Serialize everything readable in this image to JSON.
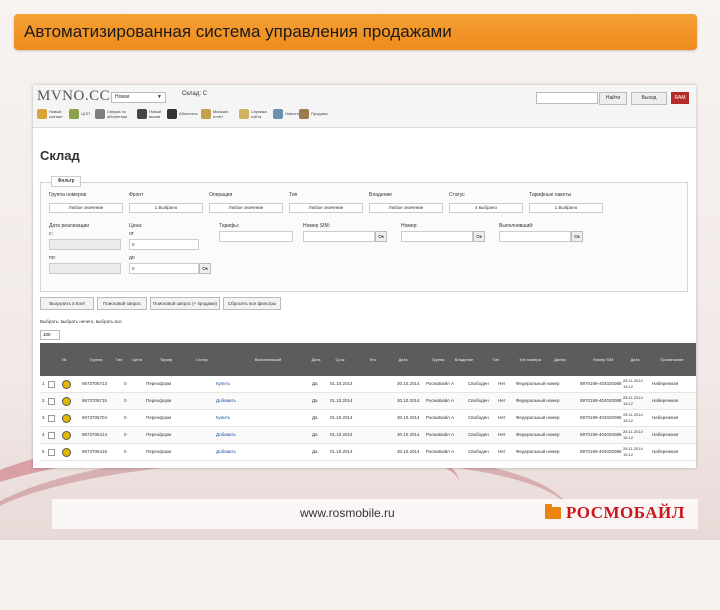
{
  "slide": {
    "title": "Автоматизированная система управления продажами",
    "footer_url": "www.rosmobile.ru",
    "brand": "РОСМОБАЙЛ",
    "colors": {
      "title_bar": "#ee8a1c",
      "brand_red": "#c9171b",
      "header_gray": "#5c5c5c"
    }
  },
  "app": {
    "logo": "MVNO.CC",
    "top_select": "Новая",
    "store_label": "Склад: С",
    "search_button": "Найти",
    "logout_button": "Выход",
    "red_button": "RAM",
    "nav": [
      "Новый контакт",
      "ЦОП",
      "Сверка по абонентам",
      "Новый вызов",
      "Абоненты",
      "Магазин отчёт",
      "Справка счёта",
      "Новости",
      "Продажи"
    ],
    "page_title": "Склад",
    "filter_tab": "Фильтр",
    "filters": {
      "labels": [
        "Группа номеров",
        "Фронт",
        "Операция",
        "Тип",
        "Владение",
        "Статус",
        "Тарифные пакеты"
      ],
      "values": [
        "Любое значение",
        "1 Выбрано",
        "Любое значение",
        "Любое значение",
        "Любое значение",
        "4 выбрано",
        "1 Выбрано"
      ],
      "date_label": "Дата реализации",
      "from_label": "с:",
      "to_label": "по:",
      "price_label": "Цена:",
      "price_from": "от",
      "price_to": "до",
      "price_from_val": "0",
      "price_to_val": "0",
      "tariff_label": "Тарифы:",
      "sim_label": "Номер SIM:",
      "number_label": "Номер:",
      "owner_label": "Выполнивший:",
      "ok": "Ок"
    },
    "actions": [
      "Выгрузить в Exel",
      "Поисковой запрос",
      "Поисковой запрос (+ продажи)",
      "Сбросить все фильтры"
    ],
    "selection_text": "Выбрать: выбрать ничего, выбрать все",
    "page_size": "100",
    "columns": [
      "№",
      "Группа",
      "Тип",
      "Цена",
      "Тариф",
      "Статус",
      "Выполнивший",
      "Дата",
      "Срок",
      "Кто",
      "Дата",
      "Группа",
      "Владение",
      "Тип",
      "Тип номера",
      "Дилер",
      "Номер SIM",
      "Дата",
      "Примечание"
    ],
    "rows": [
      {
        "n": "1",
        "num": "9673705713",
        "v": "0",
        "tariff": "Переоформ",
        "status": "Купить",
        "flag": "Да",
        "date1": "01.10.2014",
        "date2": "30.10.2014",
        "owner": "РосмоБайл А",
        "state": "Свободен",
        "yn": "Нет",
        "type": "Федеральный номер",
        "sim": "8970199-404020088",
        "date3": "28.11.2014 15:12",
        "note": "Набережная"
      },
      {
        "n": "2",
        "num": "9673705715",
        "v": "0",
        "tariff": "Переоформ",
        "status": "Добавить",
        "flag": "Да",
        "date1": "01.10.2014",
        "date2": "30.10.2014",
        "owner": "РосмоБайл А",
        "state": "Свободен",
        "yn": "Нет",
        "type": "Федеральный номер",
        "sim": "8970199-404020088",
        "date3": "28.11.2014 15:12",
        "note": "Набережная"
      },
      {
        "n": "3",
        "num": "9673705704",
        "v": "0",
        "tariff": "Переоформ",
        "status": "Купить",
        "flag": "Да",
        "date1": "01.10.2014",
        "date2": "30.10.2014",
        "owner": "РосмоБайл А",
        "state": "Свободен",
        "yn": "Нет",
        "type": "Федеральный номер",
        "sim": "8970199-404020086",
        "date3": "28.11.2014 15:12",
        "note": "Набережная"
      },
      {
        "n": "4",
        "num": "9673705414",
        "v": "0",
        "tariff": "Переоформ",
        "status": "Добавить",
        "flag": "Да",
        "date1": "01.10.2014",
        "date2": "30.10.2014",
        "owner": "РосмоБайл А",
        "state": "Свободен",
        "yn": "Нет",
        "type": "Федеральный номер",
        "sim": "8970199-404020086",
        "date3": "28.11.2014 15:12",
        "note": "Набережная"
      },
      {
        "n": "5",
        "num": "9673705416",
        "v": "0",
        "tariff": "Переоформ",
        "status": "Добавить",
        "flag": "Да",
        "date1": "01.10.2014",
        "date2": "30.10.2014",
        "owner": "РосмоБайл А",
        "state": "Свободен",
        "yn": "Нет",
        "type": "Федеральный номер",
        "sim": "8970199-404020086",
        "date3": "28.11.2014 15:12",
        "note": "Набережная"
      }
    ]
  }
}
